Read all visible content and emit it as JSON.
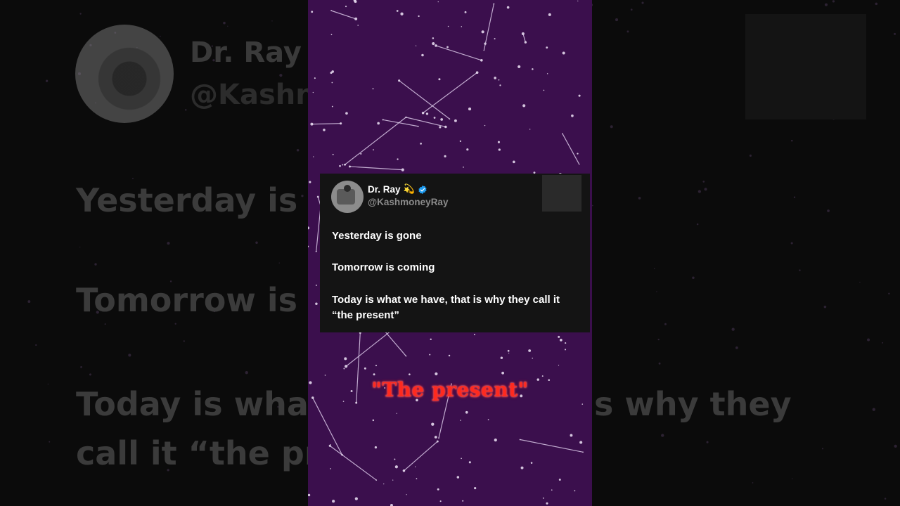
{
  "backdrop": {
    "name": "Dr. Ray",
    "handle": "@Kashn",
    "line1": "Yesterday is",
    "line2": "Tomorrow is",
    "line3": "Today is wha",
    "line3_right": "s why they",
    "line4": "call it “the pr"
  },
  "tweet": {
    "display_name": "Dr. Ray",
    "name_emoji": "💫",
    "handle": "@KashmoneyRay",
    "line1": "Yesterday is gone",
    "line2": "Tomorrow is coming",
    "line3": "Today is what we have, that is why they call it “the present”",
    "verified_icon": "verified-badge-icon",
    "verified_color": "#1d9bf0"
  },
  "caption": "\"The present\"",
  "colors": {
    "column_bg": "#3b0f4d",
    "card_bg": "#141414",
    "caption": "#ff2a1f"
  }
}
